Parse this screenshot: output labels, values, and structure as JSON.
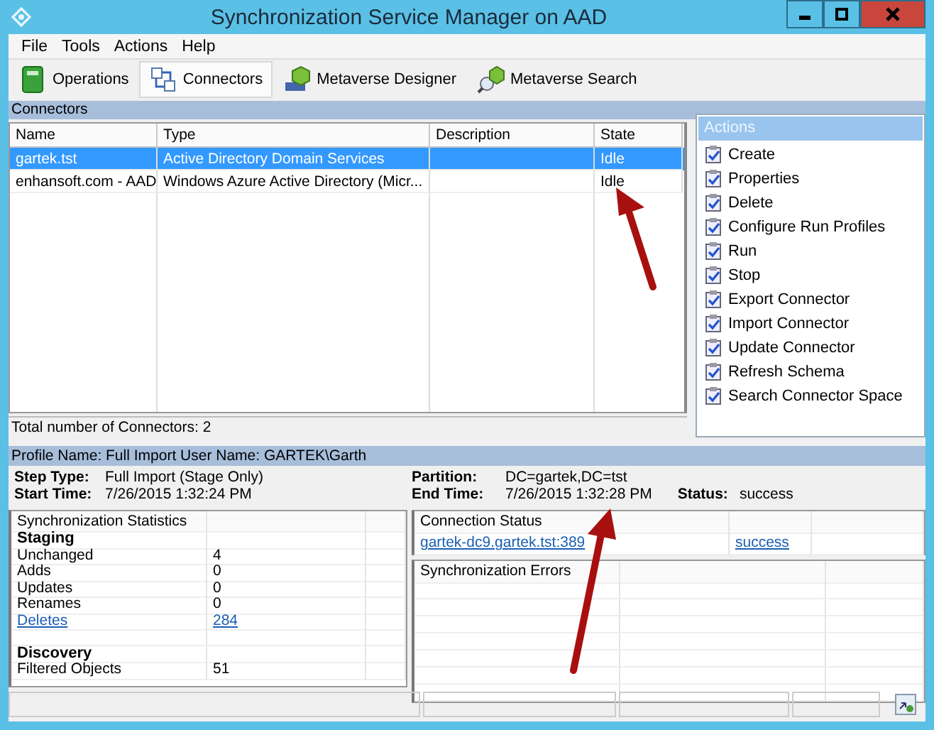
{
  "window": {
    "title": "Synchronization Service Manager on AAD"
  },
  "menu": [
    "File",
    "Tools",
    "Actions",
    "Help"
  ],
  "toolbar": [
    {
      "label": "Operations",
      "kind": "operations",
      "selected": false
    },
    {
      "label": "Connectors",
      "kind": "connectors",
      "selected": true
    },
    {
      "label": "Metaverse Designer",
      "kind": "designer",
      "selected": false
    },
    {
      "label": "Metaverse Search",
      "kind": "search",
      "selected": false
    }
  ],
  "connectors": {
    "header": "Connectors",
    "columns": [
      "Name",
      "Type",
      "Description",
      "State"
    ],
    "rows": [
      {
        "cells": [
          "gartek.tst",
          "Active Directory Domain Services",
          "",
          "Idle"
        ],
        "selected": true
      },
      {
        "cells": [
          "enhansoft.com - AAD",
          "Windows Azure Active Directory (Micr...",
          "",
          "Idle"
        ],
        "selected": false
      }
    ],
    "total": "Total number of Connectors: 2"
  },
  "actions": {
    "header": "Actions",
    "items": [
      "Create",
      "Properties",
      "Delete",
      "Configure Run Profiles",
      "Run",
      "Stop",
      "Export Connector",
      "Import Connector",
      "Update Connector",
      "Refresh Schema",
      "Search Connector Space"
    ]
  },
  "profile": {
    "header": "Profile Name: Full Import  User Name: GARTEK\\Garth",
    "left": [
      {
        "label": "Step Type:",
        "value": "Full Import (Stage Only)"
      },
      {
        "label": "Start Time:",
        "value": "7/26/2015 1:32:24 PM"
      }
    ],
    "right": [
      {
        "label": "Partition:",
        "value": "DC=gartek,DC=tst"
      },
      {
        "label": "End Time:",
        "value": "7/26/2015 1:32:28 PM"
      }
    ],
    "status_label": "Status:",
    "status_value": "success"
  },
  "statistics": {
    "header": "Synchronization Statistics",
    "rows": [
      {
        "kind": "heading",
        "label": "Staging"
      },
      {
        "kind": "row",
        "label": "Unchanged",
        "value": "4"
      },
      {
        "kind": "row",
        "label": "Adds",
        "value": "0"
      },
      {
        "kind": "row",
        "label": "Updates",
        "value": "0"
      },
      {
        "kind": "row",
        "label": "Renames",
        "value": "0"
      },
      {
        "kind": "link",
        "label": "Deletes",
        "value": "284"
      },
      {
        "kind": "blank"
      },
      {
        "kind": "heading",
        "label": "Discovery"
      },
      {
        "kind": "row",
        "label": "Filtered Objects",
        "value": "51"
      }
    ]
  },
  "connection_status": {
    "header": "Connection Status",
    "rows": [
      {
        "server": "gartek-dc9.gartek.tst:389",
        "result": "success"
      }
    ]
  },
  "sync_errors": {
    "header": "Synchronization Errors"
  }
}
